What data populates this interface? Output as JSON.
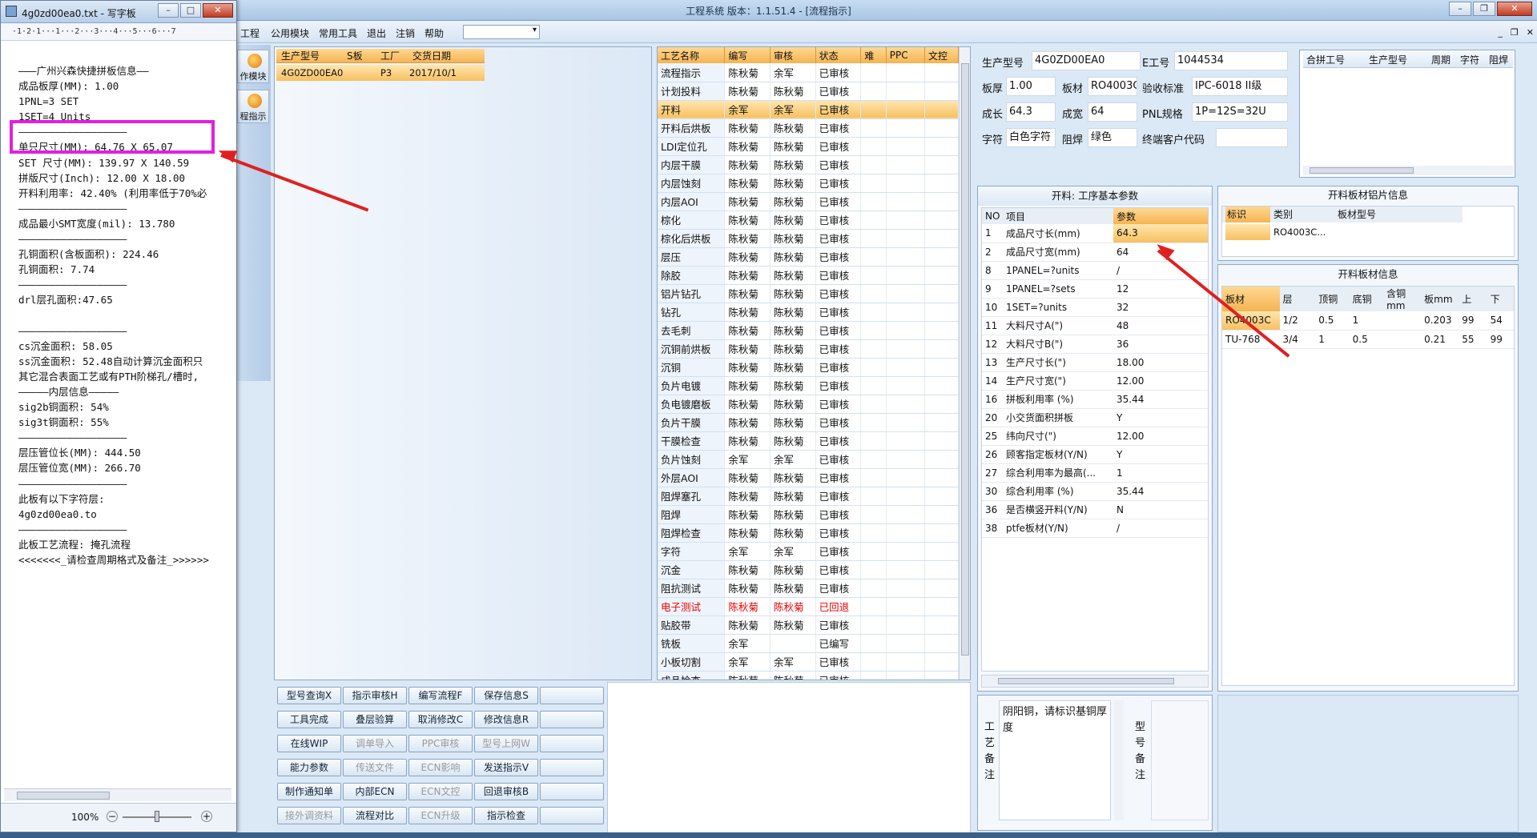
{
  "app": {
    "title": "工程系统  版本：1.1.51.4 - [流程指示]"
  },
  "menu": {
    "items": [
      "工程",
      "公用模块",
      "常用工具",
      "退出",
      "注销",
      "帮助"
    ]
  },
  "notepad": {
    "title": "4g0zd00ea0.txt - 写字板",
    "ruler": "·1·2·1···1···2···3···4···5···6···7",
    "lines": [
      "———广州兴森快捷拼板信息——",
      "成品板厚(MM): 1.00",
      "1PNL=3 SET",
      "1SET=4 Units",
      "——————————————————",
      "单只尺寸(MM): 64.76 X 65.07",
      "SET 尺寸(MM): 139.97 X 140.59",
      "拼版尺寸(Inch): 12.00 X 18.00",
      "开料利用率: 42.40% (利用率低于70%必",
      "——————————————————",
      "成品最小SMT宽度(mil): 13.780",
      "——————————————————",
      "孔铜面积(含板面积): 224.46",
      "孔铜面积: 7.74",
      "——————————————————",
      "drl层孔面积:47.65",
      "",
      "——————————————————",
      "cs沉金面积: 58.05",
      "ss沉金面积: 52.48自动计算沉金面积只",
      "其它混合表面工艺或有PTH阶梯孔/槽时,",
      "—————内层信息—————",
      "sig2b铜面积: 54%",
      "sig3t铜面积: 55%",
      "——————————————————",
      "层压管位长(MM): 444.50",
      "层压管位宽(MM): 266.70",
      "——————————————————",
      "此板有以下字符层:",
      "4g0zd00ea0.to",
      "——————————————————",
      "此板工艺流程: 掩孔流程",
      "<<<<<<<_请检查周期格式及备注_>>>>>>"
    ],
    "zoom": "100%"
  },
  "nav": {
    "btn1": "作模块",
    "btn2": "程指示"
  },
  "order": {
    "headers": [
      "生产型号",
      "S板",
      "工厂",
      "交货日期"
    ],
    "row": [
      "4G0ZD00EA0",
      "",
      "P3",
      "2017/10/1"
    ]
  },
  "process": {
    "headers": [
      "工艺名称",
      "编写",
      "审核",
      "状态",
      "难",
      "PPC",
      "文控"
    ],
    "rows": [
      [
        "流程指示",
        "陈秋菊",
        "余军",
        "已审核"
      ],
      [
        "计划投料",
        "陈秋菊",
        "陈秋菊",
        "已审核"
      ],
      [
        "开料",
        "余军",
        "余军",
        "已审核"
      ],
      [
        "开料后烘板",
        "陈秋菊",
        "陈秋菊",
        "已审核"
      ],
      [
        "LDI定位孔",
        "陈秋菊",
        "陈秋菊",
        "已审核"
      ],
      [
        "内层干膜",
        "陈秋菊",
        "陈秋菊",
        "已审核"
      ],
      [
        "内层蚀刻",
        "陈秋菊",
        "陈秋菊",
        "已审核"
      ],
      [
        "内层AOI",
        "陈秋菊",
        "陈秋菊",
        "已审核"
      ],
      [
        "棕化",
        "陈秋菊",
        "陈秋菊",
        "已审核"
      ],
      [
        "棕化后烘板",
        "陈秋菊",
        "陈秋菊",
        "已审核"
      ],
      [
        "层压",
        "陈秋菊",
        "陈秋菊",
        "已审核"
      ],
      [
        "除胶",
        "陈秋菊",
        "陈秋菊",
        "已审核"
      ],
      [
        "铝片钻孔",
        "陈秋菊",
        "陈秋菊",
        "已审核"
      ],
      [
        "钻孔",
        "陈秋菊",
        "陈秋菊",
        "已审核"
      ],
      [
        "去毛刺",
        "陈秋菊",
        "陈秋菊",
        "已审核"
      ],
      [
        "沉铜前烘板",
        "陈秋菊",
        "陈秋菊",
        "已审核"
      ],
      [
        "沉铜",
        "陈秋菊",
        "陈秋菊",
        "已审核"
      ],
      [
        "负片电镀",
        "陈秋菊",
        "陈秋菊",
        "已审核"
      ],
      [
        "负电镀磨板",
        "陈秋菊",
        "陈秋菊",
        "已审核"
      ],
      [
        "负片干膜",
        "陈秋菊",
        "陈秋菊",
        "已审核"
      ],
      [
        "干膜检查",
        "陈秋菊",
        "陈秋菊",
        "已审核"
      ],
      [
        "负片蚀刻",
        "余军",
        "余军",
        "已审核"
      ],
      [
        "外层AOI",
        "陈秋菊",
        "陈秋菊",
        "已审核"
      ],
      [
        "阻焊塞孔",
        "陈秋菊",
        "陈秋菊",
        "已审核"
      ],
      [
        "阻焊",
        "陈秋菊",
        "陈秋菊",
        "已审核"
      ],
      [
        "阻焊检查",
        "陈秋菊",
        "陈秋菊",
        "已审核"
      ],
      [
        "字符",
        "余军",
        "余军",
        "已审核"
      ],
      [
        "沉金",
        "陈秋菊",
        "陈秋菊",
        "已审核"
      ],
      [
        "阻抗测试",
        "陈秋菊",
        "陈秋菊",
        "已审核"
      ],
      [
        "电子测试",
        "陈秋菊",
        "陈秋菊",
        "已回退"
      ],
      [
        "贴胶带",
        "陈秋菊",
        "陈秋菊",
        "已审核"
      ],
      [
        "铣板",
        "余军",
        "",
        "已编写"
      ],
      [
        "小板切割",
        "余军",
        "余军",
        "已审核"
      ],
      [
        "成品检查",
        "陈秋菊",
        "陈秋菊",
        "已审核"
      ]
    ]
  },
  "buttons": [
    [
      "型号查询X",
      "指示审核H",
      "编写流程F",
      "保存信息S",
      ""
    ],
    [
      "工具完成",
      "叠层验算",
      "取消修改C",
      "修改信息R",
      ""
    ],
    [
      "在线WIP",
      "调单导入",
      "PPC审核",
      "型号上网W",
      ""
    ],
    [
      "能力参数",
      "传送文件",
      "ECN影响",
      "发送指示V",
      ""
    ],
    [
      "制作通知单",
      "内部ECN",
      "ECN文控",
      "回退审核B",
      ""
    ],
    [
      "接外调资料",
      "流程对比",
      "ECN升级",
      "指示检查",
      ""
    ]
  ],
  "info": {
    "labels": {
      "model": "生产型号",
      "eno": "E工号",
      "thick": "板厚",
      "material": "板材",
      "std": "验收标准",
      "len": "成长",
      "wid": "成宽",
      "pnl": "PNL规格",
      "char": "字符",
      "mask": "阻焊",
      "cust": "终端客户代码"
    },
    "values": {
      "model": "4G0ZD00EA0",
      "eno": "1044534",
      "thick": "1.00",
      "material": "RO4003C",
      "std": "IPC-6018 II级",
      "len": "64.3",
      "wid": "64",
      "pnl": "1P=12S=32U",
      "char": "白色字符",
      "mask": "绿色",
      "cust": ""
    }
  },
  "combine": {
    "headers": [
      "合拼工号",
      "生产型号",
      "周期",
      "字符",
      "阻焊"
    ]
  },
  "params": {
    "title": "开料: 工序基本参数",
    "headers": [
      "NO",
      "项目",
      "参数"
    ],
    "rows": [
      [
        "1",
        "成品尺寸长(mm)",
        "64.3"
      ],
      [
        "2",
        "成品尺寸宽(mm)",
        "64"
      ],
      [
        "8",
        "1PANEL=?units",
        "/"
      ],
      [
        "9",
        "1PANEL=?sets",
        "12"
      ],
      [
        "10",
        "1SET=?units",
        "32"
      ],
      [
        "11",
        "大料尺寸A(\")",
        "48"
      ],
      [
        "12",
        "大料尺寸B(\")",
        "36"
      ],
      [
        "13",
        "生产尺寸长(\")",
        "18.00"
      ],
      [
        "14",
        "生产尺寸宽(\")",
        "12.00"
      ],
      [
        "16",
        "拼板利用率 (%)",
        "35.44"
      ],
      [
        "20",
        "小交货面积拼板",
        "Y"
      ],
      [
        "25",
        "纬向尺寸(\")",
        "12.00"
      ],
      [
        "26",
        "顾客指定板材(Y/N)",
        "Y"
      ],
      [
        "27",
        "综合利用率为最高(...",
        "1"
      ],
      [
        "30",
        "综合利用率 (%)",
        "35.44"
      ],
      [
        "36",
        "是否横竖开料(Y/N)",
        "N"
      ],
      [
        "38",
        "ptfe板材(Y/N)",
        "/"
      ]
    ]
  },
  "aluminum": {
    "title": "开料板材铝片信息",
    "headers": [
      "标识",
      "类别",
      "板材型号"
    ],
    "row": [
      "",
      "RO4003C...",
      ""
    ]
  },
  "sheet": {
    "title": "开料板材信息",
    "headers": [
      "板材",
      "层",
      "顶铜",
      "底铜",
      "含铜mm",
      "板mm",
      "上",
      "下"
    ],
    "rows": [
      [
        "RO4003C",
        "1/2",
        "0.5",
        "1",
        "",
        "0.203",
        "99",
        "54"
      ],
      [
        "TU-768",
        "3/4",
        "1",
        "0.5",
        "",
        "0.21",
        "55",
        "99"
      ]
    ]
  },
  "remarks": {
    "process_label": "工艺备注",
    "process_text": "阴阳铜，请标识基铜厚度",
    "model_label": "型号备注"
  },
  "colors": {
    "accent": "#f5b452",
    "annotation_box": "#e020e0",
    "arrow": "#e02020",
    "selected_row": "#f7c060"
  }
}
